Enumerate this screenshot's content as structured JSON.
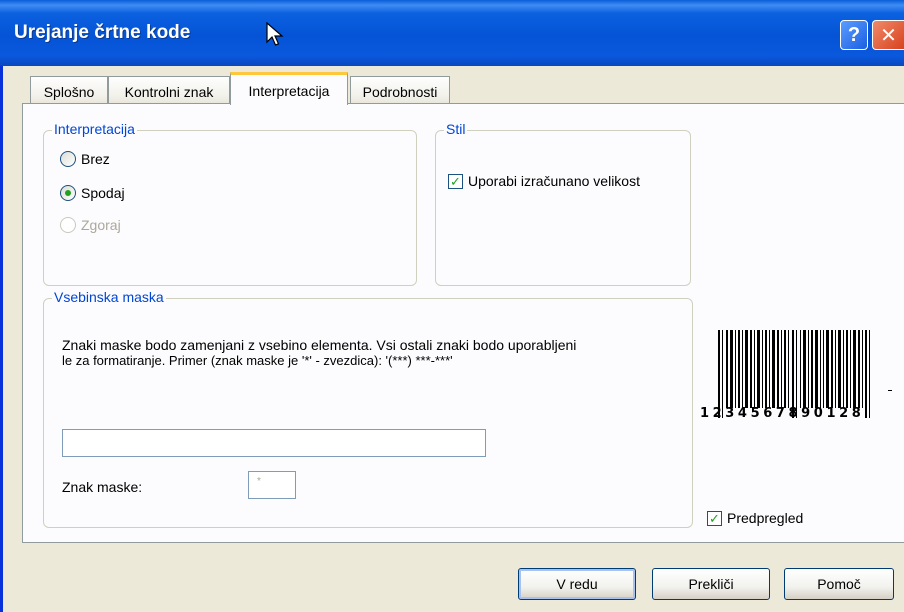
{
  "window": {
    "title": "Urejanje črtne kode",
    "help_label": "?",
    "close_label": "✕"
  },
  "tabs": [
    {
      "label": "Splošno",
      "active": false
    },
    {
      "label": "Kontrolni znak",
      "active": false
    },
    {
      "label": "Interpretacija",
      "active": true
    },
    {
      "label": "Podrobnosti",
      "active": false
    }
  ],
  "interpretation": {
    "group_label": "Interpretacija",
    "options": [
      {
        "label": "Brez",
        "checked": false,
        "disabled": false
      },
      {
        "label": "Spodaj",
        "checked": true,
        "disabled": false
      },
      {
        "label": "Zgoraj",
        "checked": false,
        "disabled": true
      }
    ]
  },
  "style": {
    "group_label": "Stil",
    "use_calculated_size_label": "Uporabi izračunano velikost",
    "use_calculated_size_checked": true
  },
  "content_mask": {
    "group_label": "Vsebinska maska",
    "description_line1": "Znaki maske bodo zamenjani z vsebino elementa. Vsi ostali znaki bodo uporabljeni",
    "description_line2": "le za formatiranje. Primer (znak maske je '*' - zvezdica): '(***) ***-***'",
    "mask_value": "",
    "mask_char_label": "Znak maske:",
    "mask_char_value": "*"
  },
  "preview": {
    "barcode_text": "1234567890128",
    "label": "Predpregled",
    "checked": true
  },
  "buttons": {
    "ok": "V redu",
    "cancel": "Prekliči",
    "help": "Pomoč"
  }
}
